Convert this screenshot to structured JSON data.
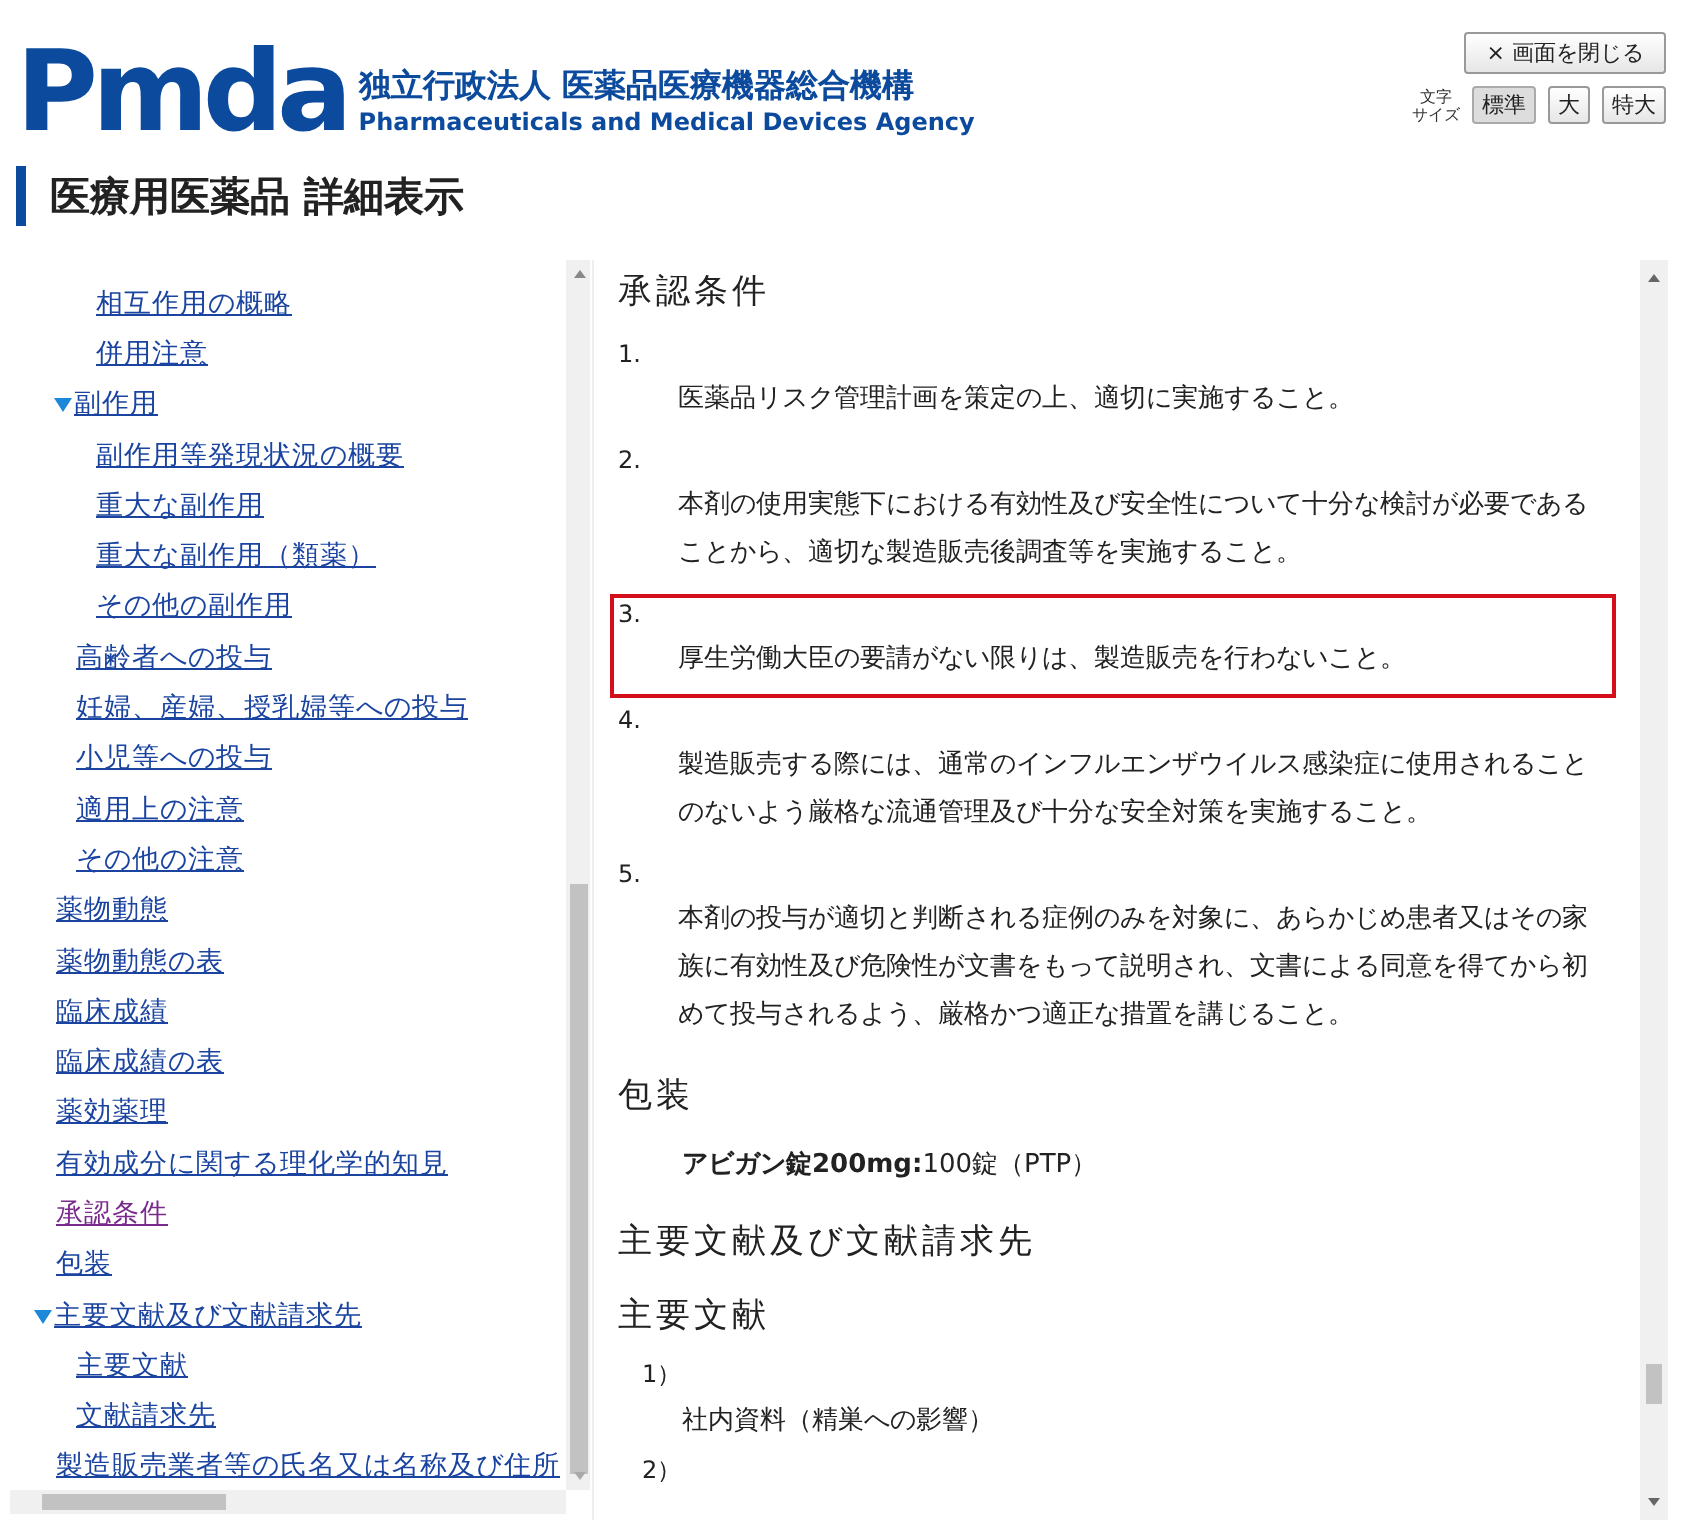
{
  "header": {
    "logo": "Pmda",
    "agency_ja": "独立行政法人 医薬品医療機器総合機構",
    "agency_en": "Pharmaceuticals and Medical Devices Agency",
    "close_button": "× 画面を閉じる",
    "font_size_label": [
      "文字",
      "サイズ"
    ],
    "font_sizes": [
      {
        "label": "標準",
        "selected": true
      },
      {
        "label": "大",
        "selected": false
      },
      {
        "label": "特大",
        "selected": false
      }
    ]
  },
  "page_title": "医療用医薬品 詳細表示",
  "nav": {
    "items": [
      {
        "children": [
          {
            "children": [
              {
                "label": "相互作用の概略",
                "visited": false
              },
              {
                "label": "併用注意",
                "visited": false
              }
            ]
          },
          {
            "label": "副作用",
            "visited": false,
            "expanded": true,
            "children": [
              {
                "label": "副作用等発現状況の概要",
                "visited": false
              },
              {
                "label": "重大な副作用",
                "visited": false
              },
              {
                "label": "重大な副作用（類薬）",
                "visited": false
              },
              {
                "label": "その他の副作用",
                "visited": false
              }
            ]
          },
          {
            "label": "高齢者への投与",
            "visited": false
          },
          {
            "label": "妊婦、産婦、授乳婦等への投与",
            "visited": false
          },
          {
            "label": "小児等への投与",
            "visited": false
          },
          {
            "label": "適用上の注意",
            "visited": false
          },
          {
            "label": "その他の注意",
            "visited": false
          }
        ]
      },
      {
        "label": "薬物動態",
        "visited": false
      },
      {
        "label": "薬物動態の表",
        "visited": false
      },
      {
        "label": "臨床成績",
        "visited": false
      },
      {
        "label": "臨床成績の表",
        "visited": false
      },
      {
        "label": "薬効薬理",
        "visited": false
      },
      {
        "label": "有効成分に関する理化学的知見",
        "visited": false
      },
      {
        "label": "承認条件",
        "visited": true
      },
      {
        "label": "包装",
        "visited": false
      },
      {
        "label": "主要文献及び文献請求先",
        "visited": false,
        "expanded": true,
        "children": [
          {
            "label": "主要文献",
            "visited": false
          },
          {
            "label": "文献請求先",
            "visited": false
          }
        ]
      },
      {
        "label": "製造販売業者等の氏名又は名称及び住所",
        "visited": false
      }
    ]
  },
  "content": {
    "approval": {
      "heading": "承認条件",
      "conditions": [
        {
          "number": "1.",
          "text": "医薬品リスク管理計画を策定の上、適切に実施すること。",
          "highlighted": false
        },
        {
          "number": "2.",
          "text": "本剤の使用実態下における有効性及び安全性について十分な検討が必要であることから、適切な製造販売後調査等を実施すること。",
          "highlighted": false
        },
        {
          "number": "3.",
          "text": "厚生労働大臣の要請がない限りは、製造販売を行わないこと。",
          "highlighted": true
        },
        {
          "number": "4.",
          "text": "製造販売する際には、通常のインフルエンザウイルス感染症に使用されることのないよう厳格な流通管理及び十分な安全対策を実施すること。",
          "highlighted": false
        },
        {
          "number": "5.",
          "text": "本剤の投与が適切と判断される症例のみを対象に、あらかじめ患者又はその家族に有効性及び危険性が文書をもって説明され、文書による同意を得てから初めて投与されるよう、厳格かつ適正な措置を講じること。",
          "highlighted": false
        }
      ]
    },
    "packaging": {
      "heading": "包装",
      "text": "**アビガン錠200mg:**100錠（PTP）"
    },
    "references": {
      "heading": "主要文献及び文献請求先",
      "subheading": "主要文献",
      "items": [
        {
          "number": "1）",
          "text": "社内資料（精巣への影響）"
        },
        {
          "number": "2）"
        }
      ]
    }
  }
}
